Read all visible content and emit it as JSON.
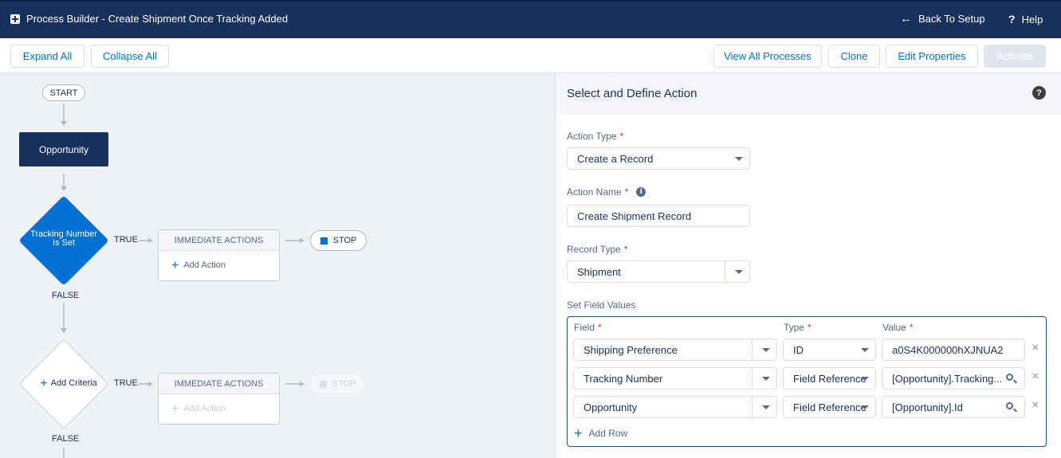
{
  "header": {
    "title": "Process Builder - Create Shipment Once Tracking Added",
    "back_label": "Back To Setup",
    "help_label": "Help"
  },
  "toolbar": {
    "expand_all": "Expand All",
    "collapse_all": "Collapse All",
    "view_all_processes": "View All Processes",
    "clone": "Clone",
    "edit_properties": "Edit Properties",
    "activate": "Activate"
  },
  "canvas": {
    "start_label": "START",
    "object_node": "Opportunity",
    "criteria1": {
      "label": "Tracking Number Is Set",
      "true_label": "TRUE",
      "false_label": "FALSE",
      "actions_header": "IMMEDIATE ACTIONS",
      "add_action": "Add Action",
      "stop_label": "STOP"
    },
    "criteria2": {
      "label": "Add Criteria",
      "true_label": "TRUE",
      "false_label": "FALSE",
      "actions_header": "IMMEDIATE ACTIONS",
      "add_action": "Add Action",
      "stop_label": "STOP"
    }
  },
  "panel": {
    "title": "Select and Define Action",
    "action_type": {
      "label": "Action Type",
      "value": "Create a Record"
    },
    "action_name": {
      "label": "Action Name",
      "value": "Create Shipment Record"
    },
    "record_type": {
      "label": "Record Type",
      "value": "Shipment"
    },
    "set_field_values": {
      "label": "Set Field Values",
      "col_field": "Field",
      "col_type": "Type",
      "col_value": "Value",
      "rows": [
        {
          "field": "Shipping Preference",
          "type": "ID",
          "value": "a0S4K000000hXJNUA2"
        },
        {
          "field": "Tracking Number",
          "type": "Field Reference",
          "value": "[Opportunity].Tracking..."
        },
        {
          "field": "Opportunity",
          "type": "Field Reference",
          "value": "[Opportunity].Id"
        }
      ],
      "add_row": "Add Row"
    }
  },
  "colors": {
    "header_bg": "#16325c",
    "brand_blue": "#0070d2",
    "required_red": "#c23934"
  }
}
